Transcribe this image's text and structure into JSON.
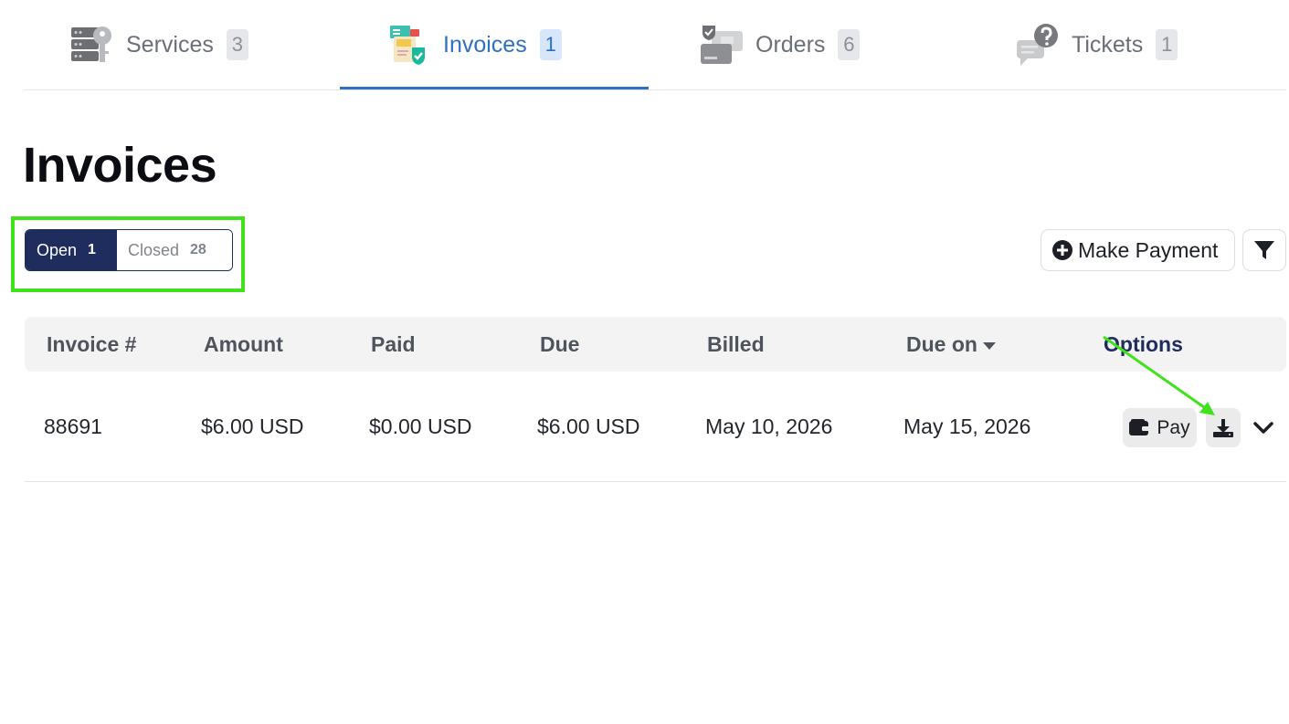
{
  "tabs": [
    {
      "label": "Services",
      "count": "3",
      "icon": "services-icon"
    },
    {
      "label": "Invoices",
      "count": "1",
      "icon": "invoices-icon"
    },
    {
      "label": "Orders",
      "count": "6",
      "icon": "orders-icon"
    },
    {
      "label": "Tickets",
      "count": "1",
      "icon": "tickets-icon"
    }
  ],
  "active_tab": "Invoices",
  "page": {
    "title": "Invoices"
  },
  "filter_toggle": {
    "open_label": "Open",
    "open_count": "1",
    "closed_label": "Closed",
    "closed_count": "28",
    "selected": "Open"
  },
  "actions": {
    "make_payment_label": "Make Payment",
    "filter_icon": "filter-icon"
  },
  "table": {
    "columns": [
      "Invoice #",
      "Amount",
      "Paid",
      "Due",
      "Billed",
      "Due on",
      "Options"
    ],
    "sorted_column": "Due on",
    "rows": [
      {
        "invoice": "88691",
        "amount": "$6.00 USD",
        "paid": "$0.00 USD",
        "due": "$6.00 USD",
        "billed": "May 10, 2026",
        "due_on": "May 15, 2026",
        "pay_label": "Pay"
      }
    ]
  },
  "colors": {
    "accent": "#2f6fc4",
    "navy": "#1f2d5e",
    "annotation": "#3fe21b"
  }
}
